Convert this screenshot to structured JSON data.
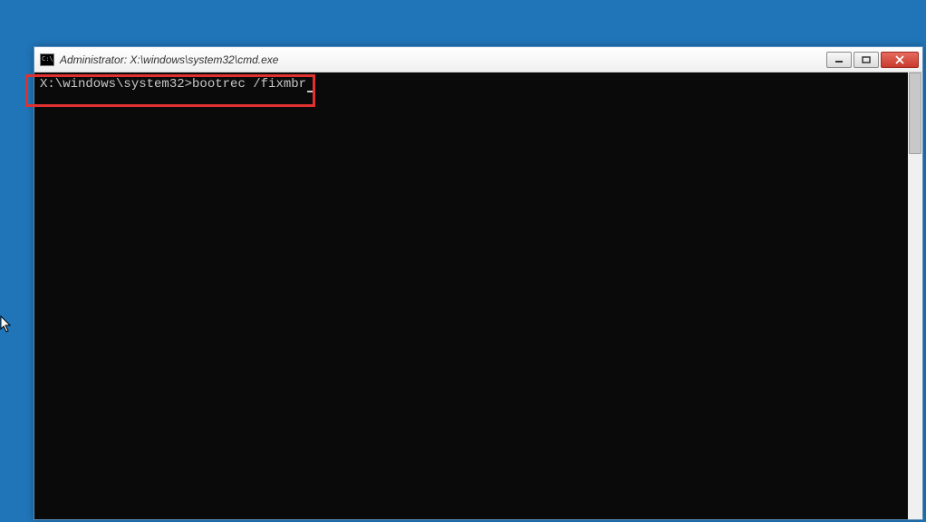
{
  "window": {
    "title": "Administrator: X:\\windows\\system32\\cmd.exe",
    "icon_label": "C:\\"
  },
  "terminal": {
    "prompt": "X:\\windows\\system32>",
    "command": "bootrec /fixmbr"
  },
  "controls": {
    "minimize": "minimize",
    "maximize": "maximize",
    "close": "close"
  }
}
